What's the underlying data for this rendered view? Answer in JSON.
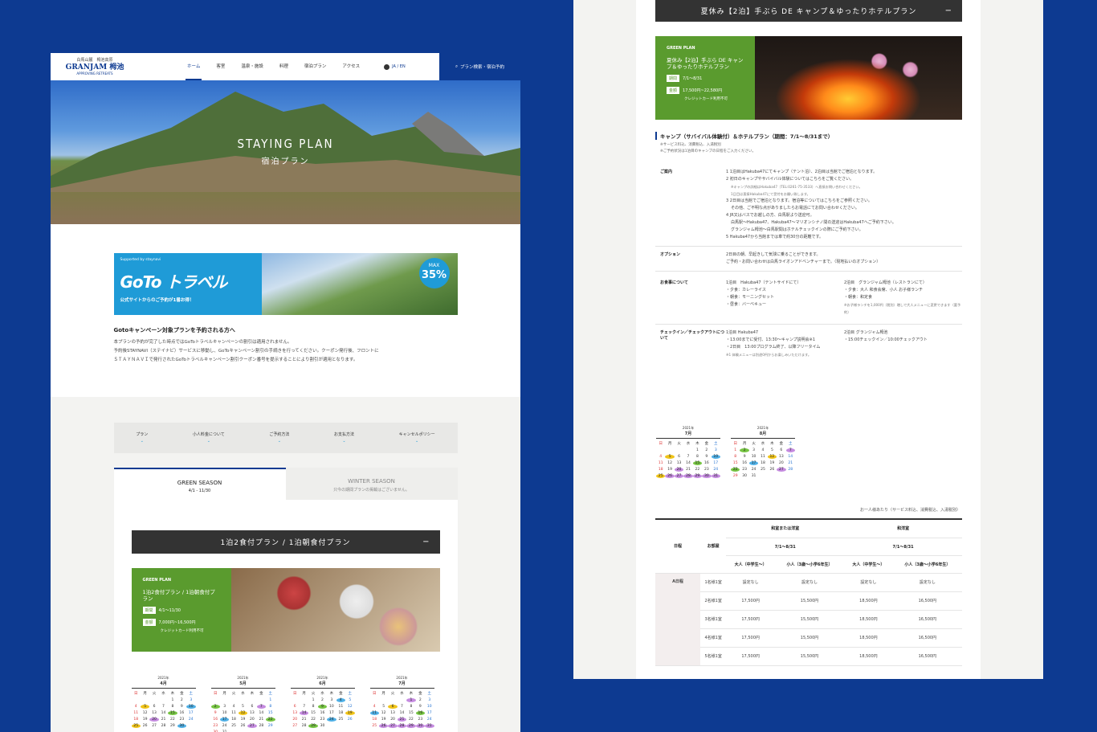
{
  "header": {
    "logo_sub": "白馬山麓　栂池高原",
    "logo_main": "GRANJAM 栂池",
    "logo_tag": "APPROVING RETREATS",
    "nav": [
      "ホーム",
      "客室",
      "温泉・施設",
      "料理",
      "宿泊プラン",
      "アクセス"
    ],
    "lang": "JA / EN",
    "search": "プラン検索・宿泊予約"
  },
  "hero": {
    "title_en": "STAYING PLAN",
    "title_ja": "宿泊プラン"
  },
  "goto": {
    "supported": "Supported by staynavi",
    "logo": "GoTo トラベル",
    "sub": "公式サイトからのご予約が1番お得！",
    "max": "MAX",
    "pct": "35%"
  },
  "goto_text": {
    "heading": "Gotoキャンペーン対象プランを予約される方へ",
    "lines": [
      "本プランの予約が完了した時点ではGoToトラベルキャンペーンの割引は適用されません。",
      "予約後STAYNAVI（ステイナビ）サービスに移動し、GoToキャンペーン割引の手続きを行ってください。クーポン発行後、フロントに",
      "ＳＴＡＹＮＡＶＩで発行されたGoToトラベルキャンペーン割引クーポン番号を提示することにより割引が適用となります。"
    ]
  },
  "filters": [
    "プラン",
    "小人料金について",
    "ご予約方法",
    "お支払方法",
    "キャンセルポリシー"
  ],
  "seasons": {
    "green": "GREEN SEASON",
    "green_range": "4/1 - 11/30",
    "winter": "WINTER SEASON",
    "winter_note": "只今の期間プランの掲載はございません。"
  },
  "plan_left": {
    "bar": "1泊2食付プラン / 1泊朝食付プラン",
    "kind": "GREEN PLAN",
    "name": "1泊2食付プラン / 1泊朝食付プラン",
    "period_label": "期間",
    "period": "4/1～11/30",
    "price_label": "金額",
    "price": "7,000円~16,500円",
    "card": "クレジットカード利用不可"
  },
  "cal_left": [
    {
      "year": "2021年",
      "month": "4月"
    },
    {
      "year": "2021年",
      "month": "5月"
    },
    {
      "year": "2021年",
      "month": "6月"
    },
    {
      "year": "2021年",
      "month": "7月"
    }
  ],
  "weekdays": [
    "日",
    "月",
    "火",
    "水",
    "木",
    "金",
    "土"
  ],
  "plan_right": {
    "bar": "夏休み【2泊】手ぶら DE キャンプ＆ゆったりホテルプラン",
    "kind": "GREEN PLAN",
    "name": "夏休み【2泊】手ぶら DE キャンプ＆ゆったりホテルプラン",
    "period_label": "期間",
    "period": "7/1～8/31",
    "price_label": "金額",
    "price": "17,500円~22,580円",
    "card": "クレジットカード利用不可"
  },
  "detail": {
    "title": "キャンプ（サバイバル体験付）＆ホテルプラン（期間：7/1～8/31まで）",
    "notes": [
      "※サービス料込、消費税込、入湯税別",
      "※ご予約状況は1泊目のキャンプの日程をご入力ください。"
    ],
    "rows": [
      {
        "key": "ご案内",
        "lines": [
          "1 1泊目はHakuba47にてキャンプ（テント泊）、2泊目は当館でご宿泊となります。",
          "2 初日のキャンプやサバイバル体験についてはこちらをご覧ください。",
          "※キャンプの詳細はHakuba47（TEL:0261-75-3533）へ直接お問い合わせください。",
          "1日目は直接Hakuba47にて受付をお願い致します。",
          "3 2日目は当館でご宿泊となります。宿泊等についてはこちらをご参照ください。",
          "その他、ご不明な点がありましたらお電話にてお問い合わせください。",
          "4 JR又はバスでお越しの方、白馬駅より送迎可。",
          "白馬駅～Hakuba47、Hakuba47～マリオンシナノ間の送迎はHakuba47へご予約下さい。",
          "グランジャム栂池～白馬駅間はホテルチェックインの際にご予約下さい。",
          "5 Hakuba47から当館までは車で約30分の距離です。"
        ]
      },
      {
        "key": "オプション",
        "lines": [
          "2日目の朝、早起きして気球に乗ることができます。",
          "ご予約・お問い合わせは白馬ライオンアドベンチャーまで。（現地払いのオプション）"
        ]
      }
    ],
    "meals_key": "お食事について",
    "meals_a": [
      "1泊目　Hakuba47（テントサイドにて）",
      "・夕食：カレーライス",
      "・朝食：モーニングセット",
      "・昼食：バーベキュー"
    ],
    "meals_b": [
      "2泊目　グランジャム栂池（レストランにて）",
      "・夕食：大人 和食会席、小人 お子様ランチ",
      "・朝食：和定食",
      "※お子様ランチを1,000円（税別）増しで大人メニューに変更できます（要予約）"
    ],
    "check_key": "チェックイン／チェックアウトについて",
    "check_a": [
      "1泊目 Hakuba47",
      "・13:00までに受付、13:30～キャンプ説明会※1",
      "・2日目　13:00プログラム終了、以降フリータイム"
    ],
    "check_b": [
      "2泊目 グランジャム栂池",
      "・15:00チェックイン／10:00チェックアウト"
    ],
    "check_note": "※1 体験メニューは別途0円からお楽しみいただけます。"
  },
  "cal_right": [
    {
      "year": "2021年",
      "month": "7月"
    },
    {
      "year": "2021年",
      "month": "8月"
    }
  ],
  "price_note": "お一人様あたり（サービス料込、消費税込、入湯税別）",
  "price_table": {
    "h_date": "日程",
    "h_room": "お部屋",
    "h_wa": "和室または洋室",
    "h_yo": "和洋室",
    "range": "7/1～8/31",
    "adult": "大人（中学生～）",
    "child": "小人（3歳～小学6年生）",
    "day": "A日程",
    "rows": [
      [
        "1名様1室",
        "設定なし",
        "設定なし",
        "設定なし",
        "設定なし"
      ],
      [
        "2名様1室",
        "17,500円",
        "15,500円",
        "18,500円",
        "16,500円"
      ],
      [
        "3名様1室",
        "17,500円",
        "15,500円",
        "18,500円",
        "16,500円"
      ],
      [
        "4名様1室",
        "17,500円",
        "15,500円",
        "18,500円",
        "16,500円"
      ],
      [
        "5名様1室",
        "17,500円",
        "15,500円",
        "18,500円",
        "16,500円"
      ]
    ]
  },
  "colors": {
    "bg": "#0d3a91",
    "green": "#5a9b2e",
    "goto": "#1f9bd7"
  }
}
